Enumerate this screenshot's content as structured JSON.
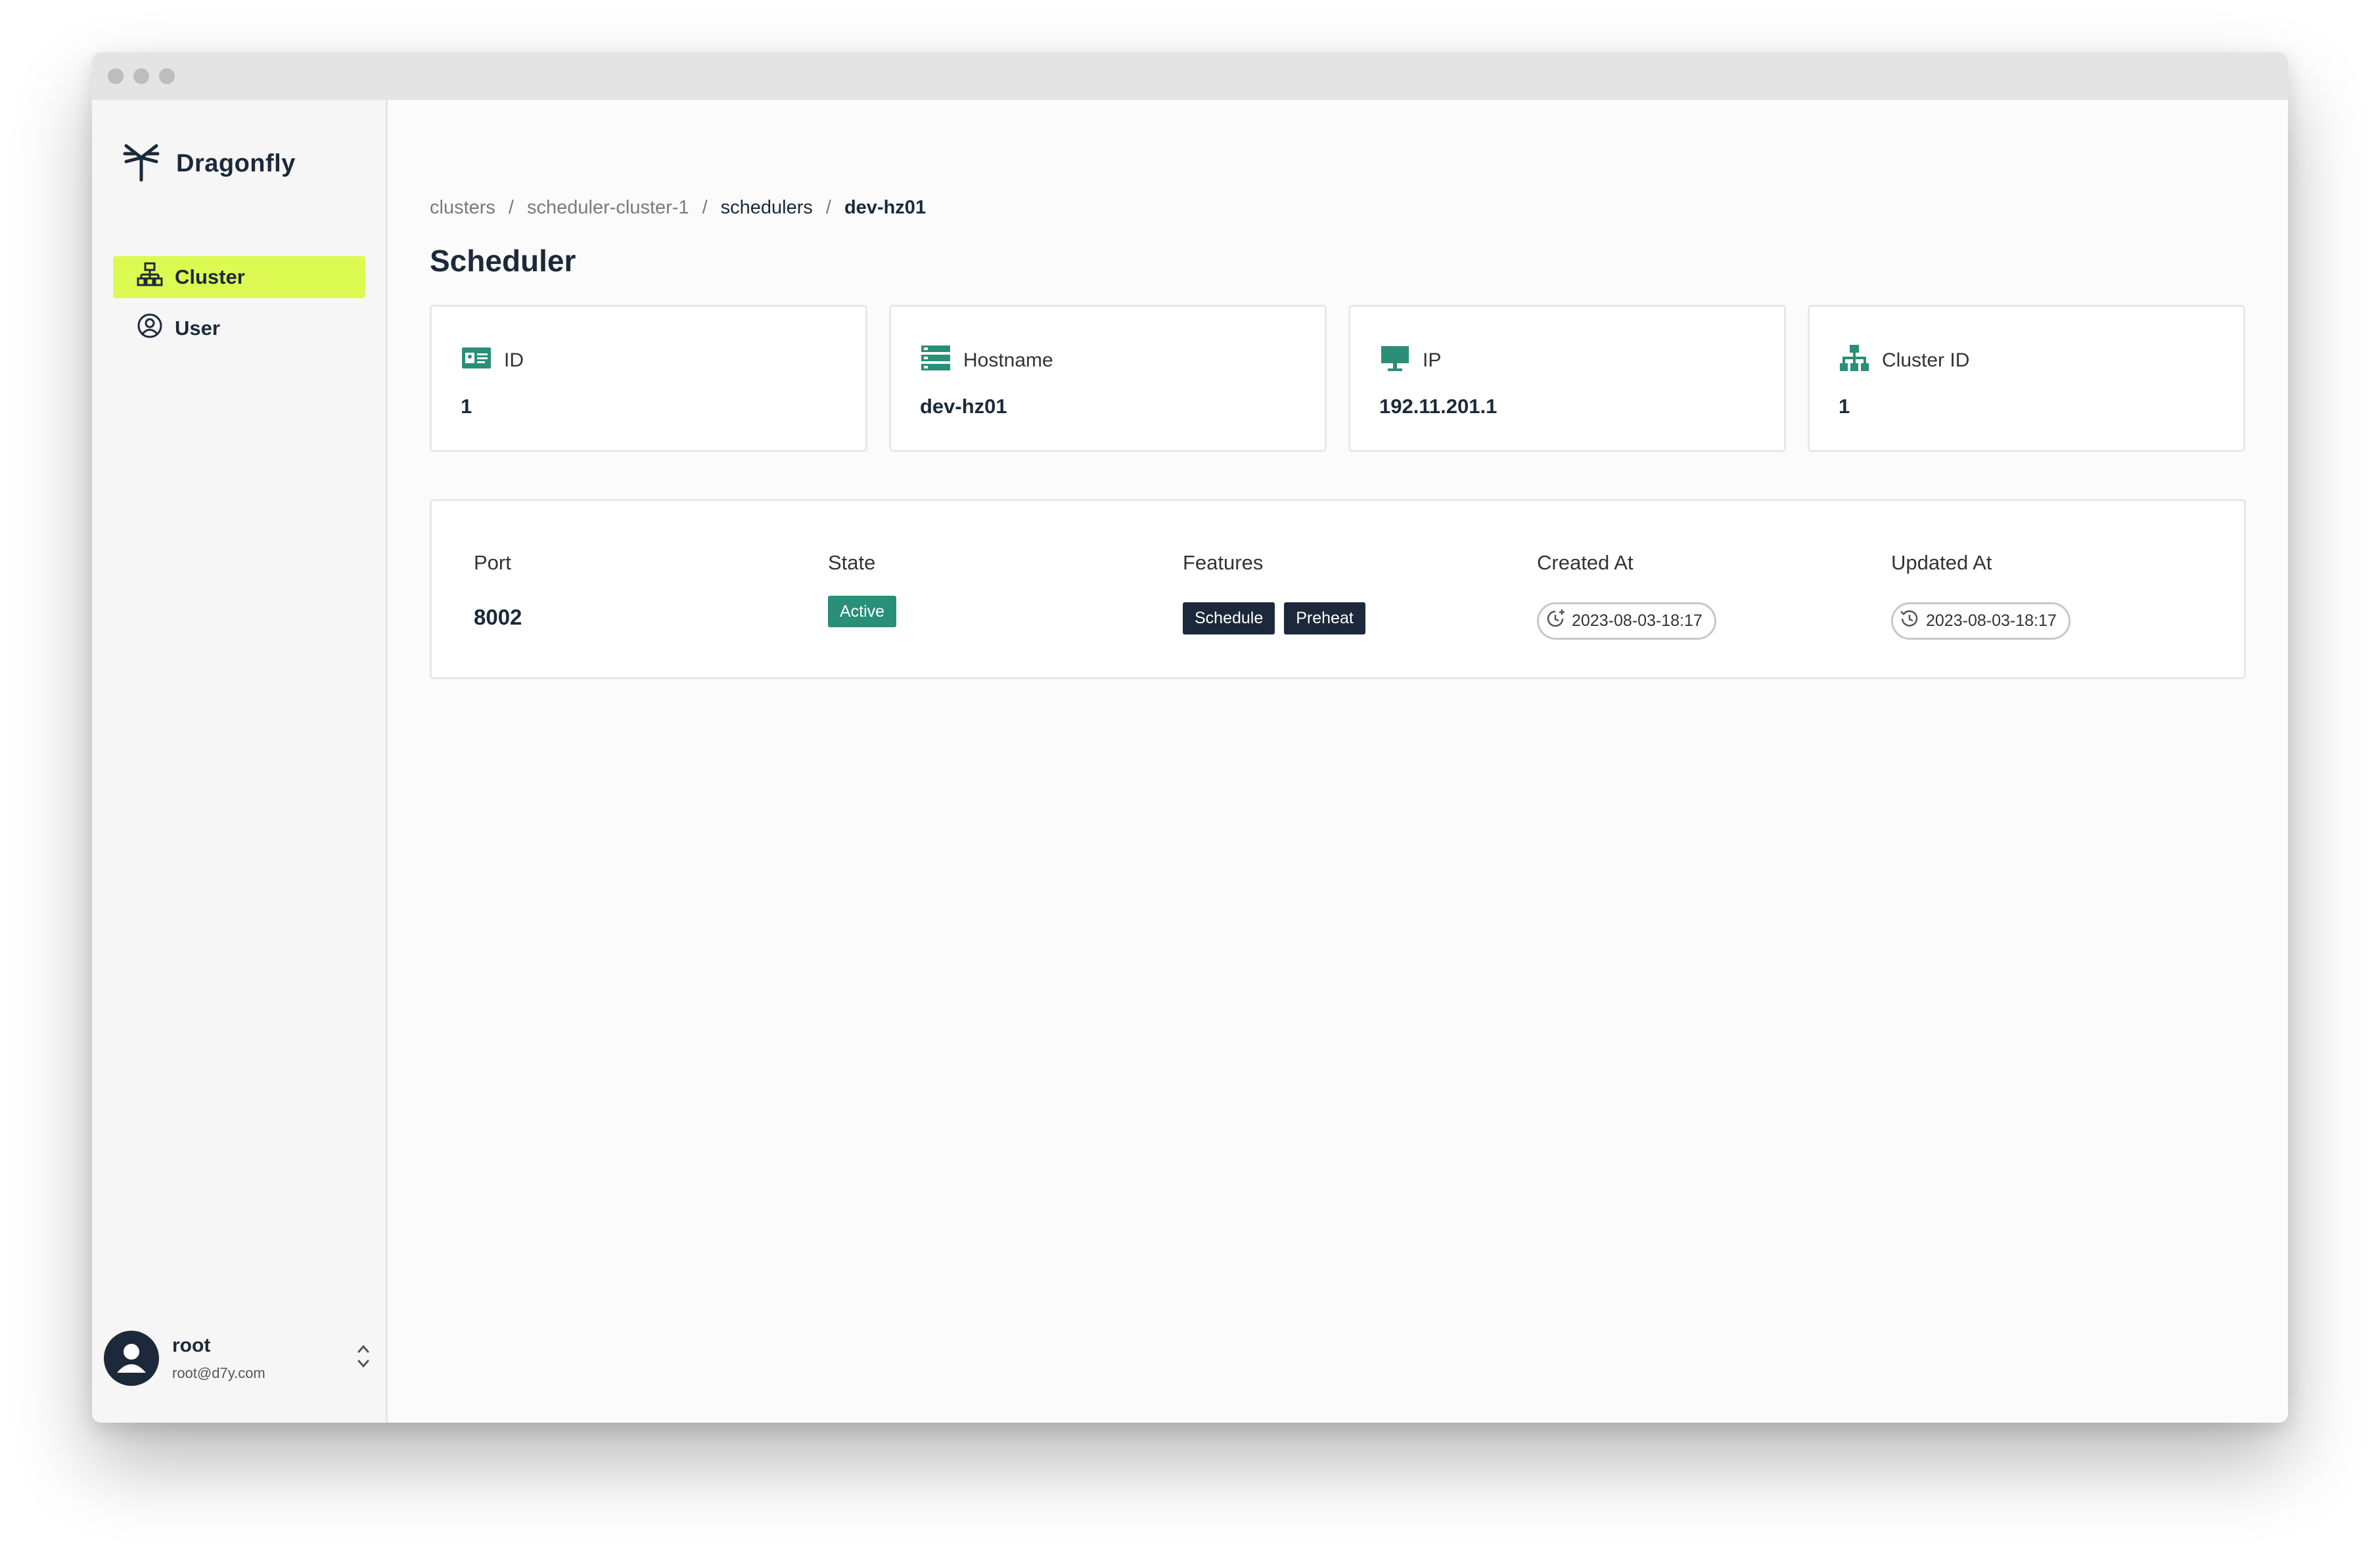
{
  "app": {
    "brand": "Dragonfly"
  },
  "sidebar": {
    "items": [
      {
        "label": "Cluster",
        "icon": "cluster-icon",
        "active": true
      },
      {
        "label": "User",
        "icon": "user-circle-icon",
        "active": false
      }
    ],
    "account": {
      "name": "root",
      "email": "root@d7y.com"
    }
  },
  "breadcrumb": [
    "clusters",
    "scheduler-cluster-1",
    "schedulers",
    "dev-hz01"
  ],
  "page_title": "Scheduler",
  "cards": [
    {
      "label": "ID",
      "value": "1",
      "icon": "id-card-icon"
    },
    {
      "label": "Hostname",
      "value": "dev-hz01",
      "icon": "server-icon"
    },
    {
      "label": "IP",
      "value": "192.11.201.1",
      "icon": "monitor-icon"
    },
    {
      "label": "Cluster ID",
      "value": "1",
      "icon": "network-tree-icon"
    }
  ],
  "details": {
    "port": {
      "label": "Port",
      "value": "8002"
    },
    "state": {
      "label": "State",
      "value": "Active"
    },
    "features": {
      "label": "Features",
      "values": [
        "Schedule",
        "Preheat"
      ]
    },
    "created_at": {
      "label": "Created At",
      "value": "2023-08-03-18:17"
    },
    "updated_at": {
      "label": "Updated At",
      "value": "2023-08-03-18:17"
    }
  },
  "colors": {
    "accent": "#dcfa52",
    "primary": "#1c293a",
    "success": "#2a8f78",
    "icon": "#2a8f78"
  }
}
